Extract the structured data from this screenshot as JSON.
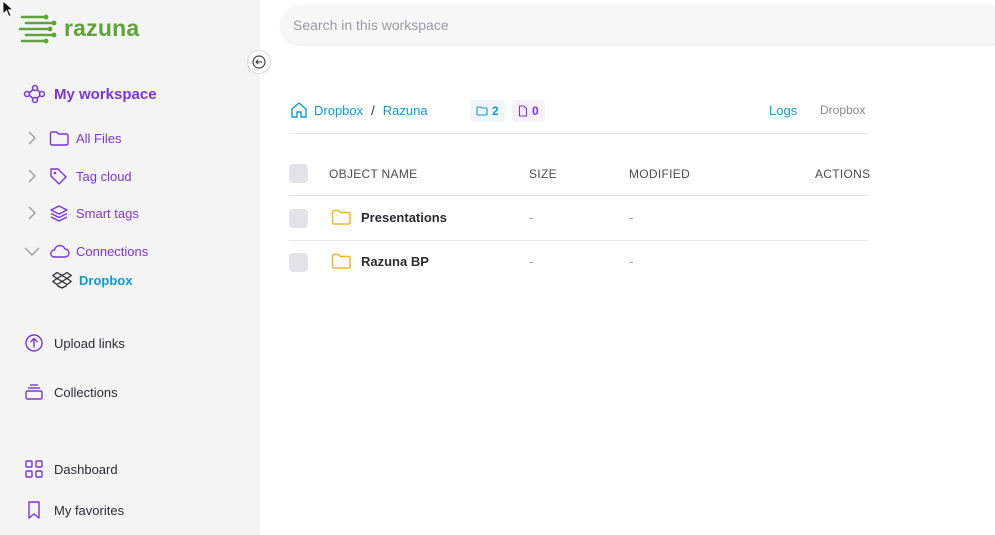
{
  "brand": {
    "name": "razuna",
    "accent": "#5fa33a"
  },
  "search": {
    "placeholder": "Search in this workspace"
  },
  "sidebar": {
    "workspace_label": "My workspace",
    "tree": [
      {
        "label": "All Files",
        "icon": "folder-icon"
      },
      {
        "label": "Tag cloud",
        "icon": "tag-icon"
      },
      {
        "label": "Smart tags",
        "icon": "layers-icon"
      },
      {
        "label": "Connections",
        "icon": "cloud-icon"
      }
    ],
    "connection_child": {
      "label": "Dropbox",
      "icon": "dropbox-icon"
    },
    "items": [
      {
        "label": "Upload links",
        "icon": "upload-icon"
      },
      {
        "label": "Collections",
        "icon": "collections-icon"
      },
      {
        "label": "Dashboard",
        "icon": "grid-icon"
      },
      {
        "label": "My favorites",
        "icon": "bookmark-icon"
      }
    ]
  },
  "breadcrumb": {
    "items": [
      "Dropbox",
      "Razuna"
    ],
    "separator": "/"
  },
  "counts": {
    "folders": "2",
    "files": "0"
  },
  "toolbar": {
    "logs_label": "Logs",
    "source_label": "Dropbox"
  },
  "table": {
    "columns": {
      "name": "OBJECT NAME",
      "size": "SIZE",
      "modified": "MODIFIED",
      "actions": "ACTIONS"
    },
    "rows": [
      {
        "name": "Presentations",
        "size": "-",
        "modified": "-"
      },
      {
        "name": "Razuna BP",
        "size": "-",
        "modified": "-"
      }
    ]
  },
  "colors": {
    "purple": "#7b35d6",
    "blue": "#0b9ad6",
    "folder": "#f2b823"
  }
}
